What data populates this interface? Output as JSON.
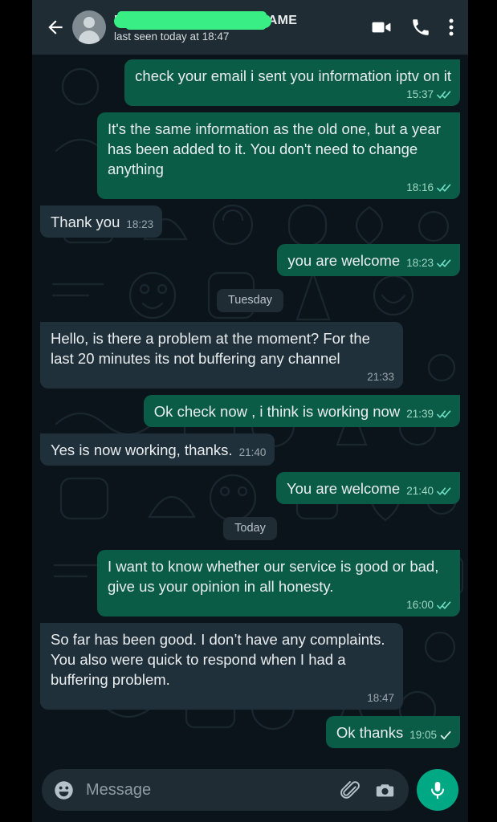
{
  "header": {
    "back_icon": "back-arrow-icon",
    "avatar_icon": "default-avatar-icon",
    "contact_name": "REDACTED CONTACT NAME",
    "status": "last seen today at 18:47",
    "video_call_icon": "video-camera-icon",
    "voice_call_icon": "phone-icon",
    "menu_icon": "three-dot-menu-icon",
    "redaction_color": "#39ef85"
  },
  "theme": {
    "background": "#0b141a",
    "header_bg": "#1f2c34",
    "outgoing_bubble": "#0a5c47",
    "incoming_bubble": "#20303a",
    "accent": "#00a884",
    "tick_read_color": "#6ddcc0",
    "text_primary": "#e9edef",
    "letterbox": "#000000"
  },
  "messages": [
    {
      "type": "message",
      "direction": "out",
      "text": "check your email i sent you information iptv on it",
      "time": "15:37",
      "ticks": "double",
      "meta_own_line": true
    },
    {
      "type": "message",
      "direction": "out",
      "text": "It's the same information as the old one, but a year has been added to it. You don't need to change anything",
      "time": "18:16",
      "ticks": "double",
      "meta_own_line": true
    },
    {
      "type": "message",
      "direction": "in",
      "text": "Thank you",
      "time": "18:23",
      "ticks": "none",
      "meta_own_line": false
    },
    {
      "type": "message",
      "direction": "out",
      "text": "you are welcome",
      "time": "18:23",
      "ticks": "double",
      "meta_own_line": false
    },
    {
      "type": "divider",
      "label": "Tuesday"
    },
    {
      "type": "message",
      "direction": "in",
      "text": "Hello, is there a problem at the moment? For the last 20 minutes its not buffering any channel",
      "time": "21:33",
      "ticks": "none",
      "meta_own_line": true
    },
    {
      "type": "message",
      "direction": "out",
      "text": "Ok check now , i think is working now",
      "time": "21:39",
      "ticks": "double",
      "meta_own_line": false
    },
    {
      "type": "message",
      "direction": "in",
      "text": "Yes is now working, thanks.",
      "time": "21:40",
      "ticks": "none",
      "meta_own_line": false
    },
    {
      "type": "message",
      "direction": "out",
      "text": "You are welcome",
      "time": "21:40",
      "ticks": "double",
      "meta_own_line": false
    },
    {
      "type": "divider",
      "label": "Today"
    },
    {
      "type": "message",
      "direction": "out",
      "text": "I want to know whether our service is good or bad, give us your opinion in all honesty.",
      "time": "16:00",
      "ticks": "double",
      "meta_own_line": true
    },
    {
      "type": "message",
      "direction": "in",
      "text": "So far has been good. I don’t have any complaints. You also were quick to respond when I had a buffering problem.",
      "time": "18:47",
      "ticks": "none",
      "meta_own_line": true
    },
    {
      "type": "message",
      "direction": "out",
      "text": "Ok thanks",
      "time": "19:05",
      "ticks": "single",
      "meta_own_line": false
    }
  ],
  "composer": {
    "emoji_icon": "smiley-face-icon",
    "placeholder": "Message",
    "value": "",
    "attach_icon": "paperclip-icon",
    "camera_icon": "camera-icon",
    "mic_icon": "microphone-icon"
  }
}
